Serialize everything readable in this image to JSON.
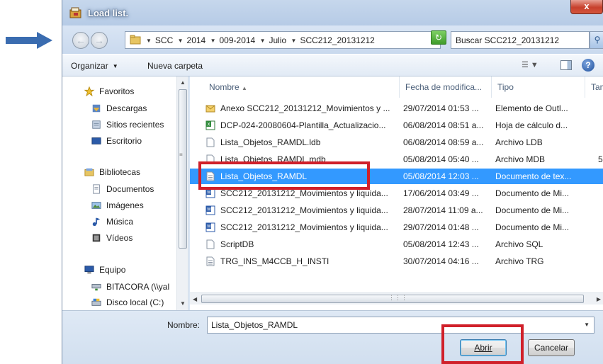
{
  "window": {
    "title": "Load list.",
    "close_label": "x"
  },
  "address": {
    "crumbs": [
      "SCC",
      "2014",
      "009-2014",
      "Julio",
      "SCC212_20131212"
    ],
    "search_placeholder": "Buscar SCC212_20131212"
  },
  "toolbar": {
    "organize_label": "Organizar",
    "new_folder_label": "Nueva carpeta"
  },
  "nav": {
    "items": [
      {
        "label": "Favoritos",
        "icon": "star-icon"
      },
      {
        "label": "Descargas",
        "icon": "downloads-icon"
      },
      {
        "label": "Sitios recientes",
        "icon": "recent-places-icon"
      },
      {
        "label": "Escritorio",
        "icon": "desktop-icon"
      },
      {
        "label": "Bibliotecas",
        "icon": "libraries-icon"
      },
      {
        "label": "Documentos",
        "icon": "documents-icon"
      },
      {
        "label": "Imágenes",
        "icon": "pictures-icon"
      },
      {
        "label": "Música",
        "icon": "music-icon"
      },
      {
        "label": "Vídeos",
        "icon": "videos-icon"
      },
      {
        "label": "Equipo",
        "icon": "computer-icon"
      },
      {
        "label": "BITACORA (\\\\yal",
        "icon": "network-drive-icon"
      },
      {
        "label": "Disco local (C:)",
        "icon": "local-disk-icon"
      }
    ]
  },
  "columns": {
    "name": "Nombre",
    "date": "Fecha de modifica...",
    "type": "Tipo",
    "size": "Tam"
  },
  "files": [
    {
      "name": "Anexo SCC212_20131212_Movimientos y ...",
      "date": "29/07/2014 01:53 ...",
      "type": "Elemento de Outl...",
      "size": "",
      "icon": "outlook-item-icon",
      "selected": false
    },
    {
      "name": "DCP-024-20080604-Plantilla_Actualizacio...",
      "date": "06/08/2014 08:51 a...",
      "type": "Hoja de cálculo d...",
      "size": "",
      "icon": "excel-file-icon",
      "selected": false
    },
    {
      "name": "Lista_Objetos_RAMDL.ldb",
      "date": "06/08/2014 08:59 a...",
      "type": "Archivo LDB",
      "size": "",
      "icon": "generic-file-icon",
      "selected": false
    },
    {
      "name": "Lista_Objetos_RAMDL.mdb",
      "date": "05/08/2014 05:40 ...",
      "type": "Archivo MDB",
      "size": "5",
      "icon": "generic-file-icon",
      "selected": false
    },
    {
      "name": "Lista_Objetos_RAMDL",
      "date": "05/08/2014 12:03 ...",
      "type": "Documento de tex...",
      "size": "",
      "icon": "text-file-icon",
      "selected": true
    },
    {
      "name": "SCC212_20131212_Movimientos y liquida...",
      "date": "17/06/2014 03:49 ...",
      "type": "Documento de Mi...",
      "size": "",
      "icon": "word-file-icon",
      "selected": false
    },
    {
      "name": "SCC212_20131212_Movimientos y liquida...",
      "date": "28/07/2014 11:09 a...",
      "type": "Documento de Mi...",
      "size": "",
      "icon": "word-file-icon",
      "selected": false
    },
    {
      "name": "SCC212_20131212_Movimientos y liquida...",
      "date": "29/07/2014 01:48 ...",
      "type": "Documento de Mi...",
      "size": "",
      "icon": "word-file-icon",
      "selected": false
    },
    {
      "name": "ScriptDB",
      "date": "05/08/2014 12:43 ...",
      "type": "Archivo SQL",
      "size": "",
      "icon": "generic-file-icon",
      "selected": false
    },
    {
      "name": "TRG_INS_M4CCB_H_INSTI",
      "date": "30/07/2014 04:16 ...",
      "type": "Archivo TRG",
      "size": "",
      "icon": "text-file-icon",
      "selected": false
    }
  ],
  "bottom": {
    "filename_label": "Nombre:",
    "filename_value": "Lista_Objetos_RAMDL",
    "open_label": "Abrir",
    "cancel_label": "Cancelar"
  },
  "colors": {
    "selection": "#3399ff",
    "highlight": "#d0202a",
    "arrow": "#3a6cb0"
  }
}
